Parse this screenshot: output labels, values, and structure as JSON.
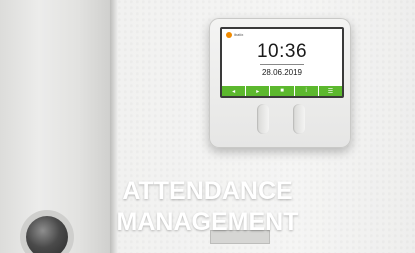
{
  "device": {
    "brand_text": "ibatix",
    "time": "10:36",
    "date": "28.06.2019",
    "buttons": [
      "◂",
      "▸",
      "■",
      "i",
      "☰"
    ]
  },
  "caption": {
    "line1": "ATTENDANCE",
    "line2": "MANAGEMENT"
  }
}
